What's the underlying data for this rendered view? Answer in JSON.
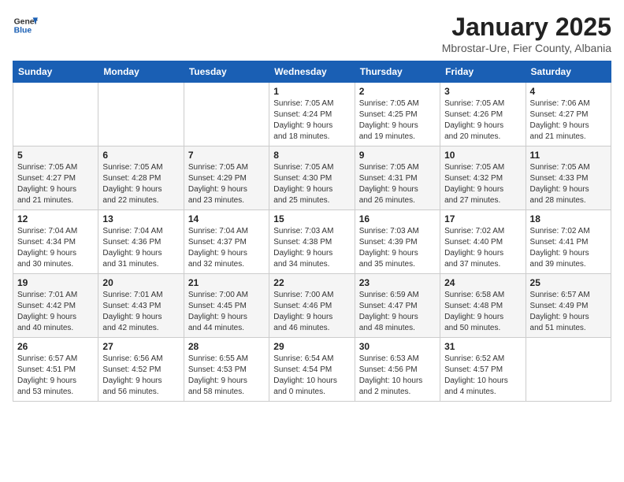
{
  "header": {
    "logo_general": "General",
    "logo_blue": "Blue",
    "title": "January 2025",
    "subtitle": "Mbrostar-Ure, Fier County, Albania"
  },
  "weekdays": [
    "Sunday",
    "Monday",
    "Tuesday",
    "Wednesday",
    "Thursday",
    "Friday",
    "Saturday"
  ],
  "weeks": [
    [
      {
        "day": "",
        "info": ""
      },
      {
        "day": "",
        "info": ""
      },
      {
        "day": "",
        "info": ""
      },
      {
        "day": "1",
        "info": "Sunrise: 7:05 AM\nSunset: 4:24 PM\nDaylight: 9 hours\nand 18 minutes."
      },
      {
        "day": "2",
        "info": "Sunrise: 7:05 AM\nSunset: 4:25 PM\nDaylight: 9 hours\nand 19 minutes."
      },
      {
        "day": "3",
        "info": "Sunrise: 7:05 AM\nSunset: 4:26 PM\nDaylight: 9 hours\nand 20 minutes."
      },
      {
        "day": "4",
        "info": "Sunrise: 7:06 AM\nSunset: 4:27 PM\nDaylight: 9 hours\nand 21 minutes."
      }
    ],
    [
      {
        "day": "5",
        "info": "Sunrise: 7:05 AM\nSunset: 4:27 PM\nDaylight: 9 hours\nand 21 minutes."
      },
      {
        "day": "6",
        "info": "Sunrise: 7:05 AM\nSunset: 4:28 PM\nDaylight: 9 hours\nand 22 minutes."
      },
      {
        "day": "7",
        "info": "Sunrise: 7:05 AM\nSunset: 4:29 PM\nDaylight: 9 hours\nand 23 minutes."
      },
      {
        "day": "8",
        "info": "Sunrise: 7:05 AM\nSunset: 4:30 PM\nDaylight: 9 hours\nand 25 minutes."
      },
      {
        "day": "9",
        "info": "Sunrise: 7:05 AM\nSunset: 4:31 PM\nDaylight: 9 hours\nand 26 minutes."
      },
      {
        "day": "10",
        "info": "Sunrise: 7:05 AM\nSunset: 4:32 PM\nDaylight: 9 hours\nand 27 minutes."
      },
      {
        "day": "11",
        "info": "Sunrise: 7:05 AM\nSunset: 4:33 PM\nDaylight: 9 hours\nand 28 minutes."
      }
    ],
    [
      {
        "day": "12",
        "info": "Sunrise: 7:04 AM\nSunset: 4:34 PM\nDaylight: 9 hours\nand 30 minutes."
      },
      {
        "day": "13",
        "info": "Sunrise: 7:04 AM\nSunset: 4:36 PM\nDaylight: 9 hours\nand 31 minutes."
      },
      {
        "day": "14",
        "info": "Sunrise: 7:04 AM\nSunset: 4:37 PM\nDaylight: 9 hours\nand 32 minutes."
      },
      {
        "day": "15",
        "info": "Sunrise: 7:03 AM\nSunset: 4:38 PM\nDaylight: 9 hours\nand 34 minutes."
      },
      {
        "day": "16",
        "info": "Sunrise: 7:03 AM\nSunset: 4:39 PM\nDaylight: 9 hours\nand 35 minutes."
      },
      {
        "day": "17",
        "info": "Sunrise: 7:02 AM\nSunset: 4:40 PM\nDaylight: 9 hours\nand 37 minutes."
      },
      {
        "day": "18",
        "info": "Sunrise: 7:02 AM\nSunset: 4:41 PM\nDaylight: 9 hours\nand 39 minutes."
      }
    ],
    [
      {
        "day": "19",
        "info": "Sunrise: 7:01 AM\nSunset: 4:42 PM\nDaylight: 9 hours\nand 40 minutes."
      },
      {
        "day": "20",
        "info": "Sunrise: 7:01 AM\nSunset: 4:43 PM\nDaylight: 9 hours\nand 42 minutes."
      },
      {
        "day": "21",
        "info": "Sunrise: 7:00 AM\nSunset: 4:45 PM\nDaylight: 9 hours\nand 44 minutes."
      },
      {
        "day": "22",
        "info": "Sunrise: 7:00 AM\nSunset: 4:46 PM\nDaylight: 9 hours\nand 46 minutes."
      },
      {
        "day": "23",
        "info": "Sunrise: 6:59 AM\nSunset: 4:47 PM\nDaylight: 9 hours\nand 48 minutes."
      },
      {
        "day": "24",
        "info": "Sunrise: 6:58 AM\nSunset: 4:48 PM\nDaylight: 9 hours\nand 50 minutes."
      },
      {
        "day": "25",
        "info": "Sunrise: 6:57 AM\nSunset: 4:49 PM\nDaylight: 9 hours\nand 51 minutes."
      }
    ],
    [
      {
        "day": "26",
        "info": "Sunrise: 6:57 AM\nSunset: 4:51 PM\nDaylight: 9 hours\nand 53 minutes."
      },
      {
        "day": "27",
        "info": "Sunrise: 6:56 AM\nSunset: 4:52 PM\nDaylight: 9 hours\nand 56 minutes."
      },
      {
        "day": "28",
        "info": "Sunrise: 6:55 AM\nSunset: 4:53 PM\nDaylight: 9 hours\nand 58 minutes."
      },
      {
        "day": "29",
        "info": "Sunrise: 6:54 AM\nSunset: 4:54 PM\nDaylight: 10 hours\nand 0 minutes."
      },
      {
        "day": "30",
        "info": "Sunrise: 6:53 AM\nSunset: 4:56 PM\nDaylight: 10 hours\nand 2 minutes."
      },
      {
        "day": "31",
        "info": "Sunrise: 6:52 AM\nSunset: 4:57 PM\nDaylight: 10 hours\nand 4 minutes."
      },
      {
        "day": "",
        "info": ""
      }
    ]
  ]
}
